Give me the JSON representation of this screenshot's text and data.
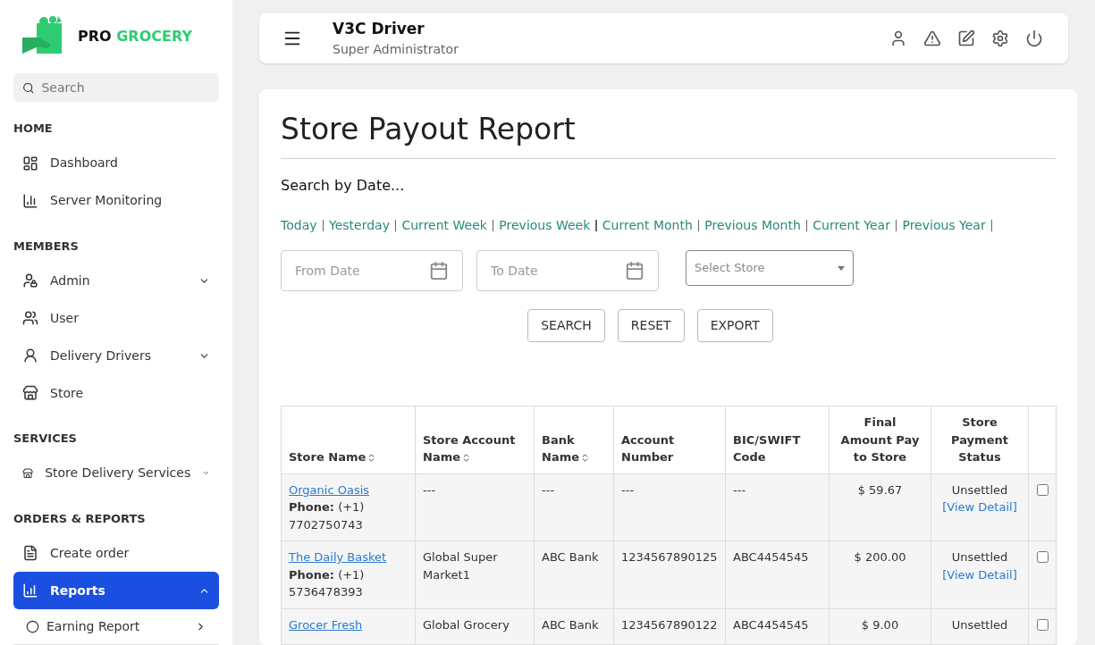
{
  "brand": {
    "first": "PRO",
    "second": "GROCERY"
  },
  "sidebar": {
    "search": {
      "placeholder": "Search"
    },
    "sections": [
      {
        "title": "HOME",
        "items": [
          {
            "label": "Dashboard",
            "selected": false
          },
          {
            "label": "Server Monitoring",
            "selected": false
          }
        ]
      },
      {
        "title": "MEMBERS",
        "items": [
          {
            "label": "Admin",
            "selected": false,
            "expanded": false
          },
          {
            "label": "User",
            "selected": false
          },
          {
            "label": "Delivery Drivers",
            "selected": false,
            "expanded": false
          },
          {
            "label": "Store",
            "selected": false
          }
        ]
      },
      {
        "title": "SERVICES",
        "items": [
          {
            "label": "Store Delivery Services",
            "selected": false,
            "expanded": false
          }
        ]
      },
      {
        "title": "ORDERS & REPORTS",
        "items": [
          {
            "label": "Create order",
            "selected": false
          },
          {
            "label": "Reports",
            "selected": true,
            "expanded": true,
            "children": [
              {
                "label": "Earning Report",
                "selected": false
              }
            ]
          }
        ]
      }
    ]
  },
  "header": {
    "name": "V3C Driver",
    "role": "Super Administrator"
  },
  "page": {
    "title": "Store Payout Report",
    "search_label": "Search by Date...",
    "quick_ranges": [
      "Today",
      "Yesterday",
      "Current Week",
      "Previous Week",
      "Current Month",
      "Previous Month",
      "Current Year",
      "Previous Year"
    ],
    "from_date": {
      "placeholder": "From Date"
    },
    "to_date": {
      "placeholder": "To Date"
    },
    "store_select": {
      "placeholder": "Select Store"
    },
    "buttons": [
      "SEARCH",
      "RESET",
      "EXPORT"
    ]
  },
  "table": {
    "columns": [
      {
        "label": "Store Name",
        "sortable": true
      },
      {
        "label": "Store Account Name",
        "sortable": true
      },
      {
        "label": "Bank Name",
        "sortable": true
      },
      {
        "label": "Account Number",
        "sortable": false
      },
      {
        "label": "BIC/SWIFT Code",
        "sortable": false
      },
      {
        "label": "Final Amount Pay to Store",
        "sortable": false
      },
      {
        "label": "Store Payment Status",
        "sortable": false
      }
    ],
    "rows": [
      {
        "store": "Organic Oasis",
        "phone_label": "Phone:",
        "phone": "(+1) 7702750743",
        "account_name": "---",
        "bank": "---",
        "account_number": "---",
        "swift": "---",
        "amount": "$ 59.67",
        "status": "Unsettled",
        "detail": "[View Detail]",
        "checked": false
      },
      {
        "store": "The Daily Basket",
        "phone_label": "Phone:",
        "phone": "(+1) 5736478393",
        "account_name": "Global Super Market1",
        "bank": "ABC Bank",
        "account_number": "1234567890125",
        "swift": "ABC4454545",
        "amount": "$ 200.00",
        "status": "Unsettled",
        "detail": "[View Detail]",
        "checked": false
      },
      {
        "store": "Grocer Fresh",
        "account_name": "Global Grocery",
        "bank": "ABC Bank",
        "account_number": "1234567890122",
        "swift": "ABC4454545",
        "amount": "$ 9.00",
        "status": "Unsettled",
        "checked": false
      }
    ]
  }
}
